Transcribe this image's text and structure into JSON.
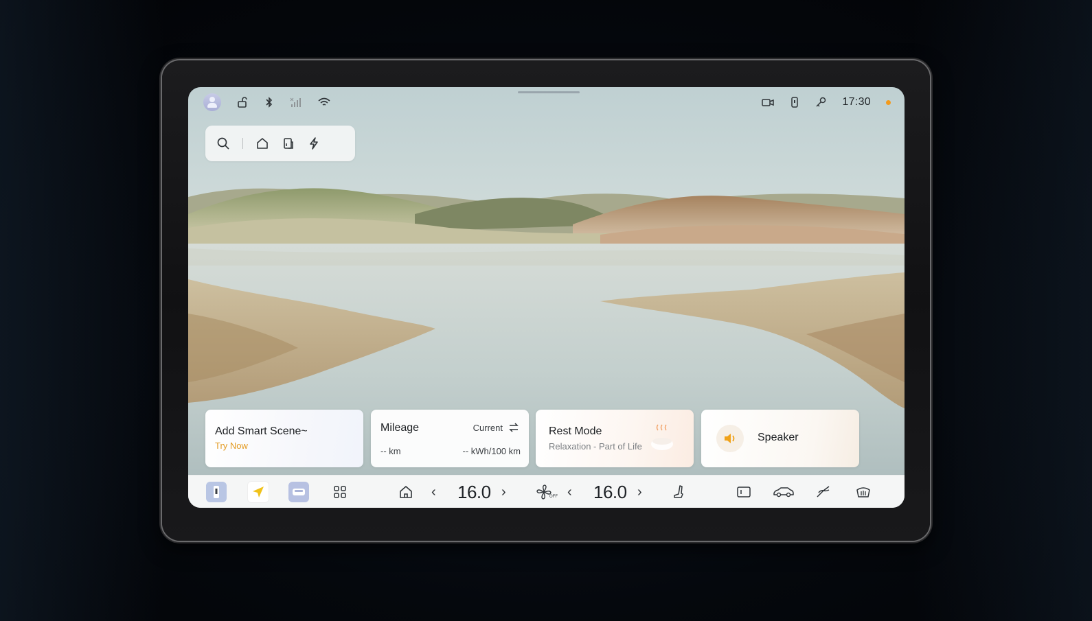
{
  "status_bar": {
    "time": "17:30",
    "left_icons": [
      "avatar-icon",
      "unlock-icon",
      "bluetooth-icon",
      "signal-icon",
      "wifi-icon"
    ],
    "right_icons": [
      "camera-icon",
      "phone-key-icon",
      "key-icon"
    ],
    "indicator_color": "#f39a1c"
  },
  "quick_pill": {
    "icons": [
      "search-icon",
      "home-icon",
      "document-icon",
      "lightning-icon"
    ]
  },
  "cards": {
    "smart_scene": {
      "title": "Add Smart Scene~",
      "action": "Try Now"
    },
    "mileage": {
      "title": "Mileage",
      "mode": "Current",
      "distance": "-- km",
      "consumption": "-- kWh/100 km"
    },
    "rest_mode": {
      "title": "Rest Mode",
      "subtitle": "Relaxation - Part of Life"
    },
    "speaker": {
      "title": "Speaker"
    }
  },
  "dock": {
    "left_temp": "16.0",
    "right_temp": "16.0",
    "fan_state": "OFF",
    "accent_color": "#f0a21a",
    "apps": [
      "phone-app-icon",
      "navigation-icon",
      "car-icon",
      "apps-grid-icon"
    ],
    "controls": [
      "home-icon",
      "fan-icon",
      "seat-heat-icon",
      "display-icon",
      "car-settings-icon",
      "wiper-icon",
      "defrost-icon"
    ]
  }
}
